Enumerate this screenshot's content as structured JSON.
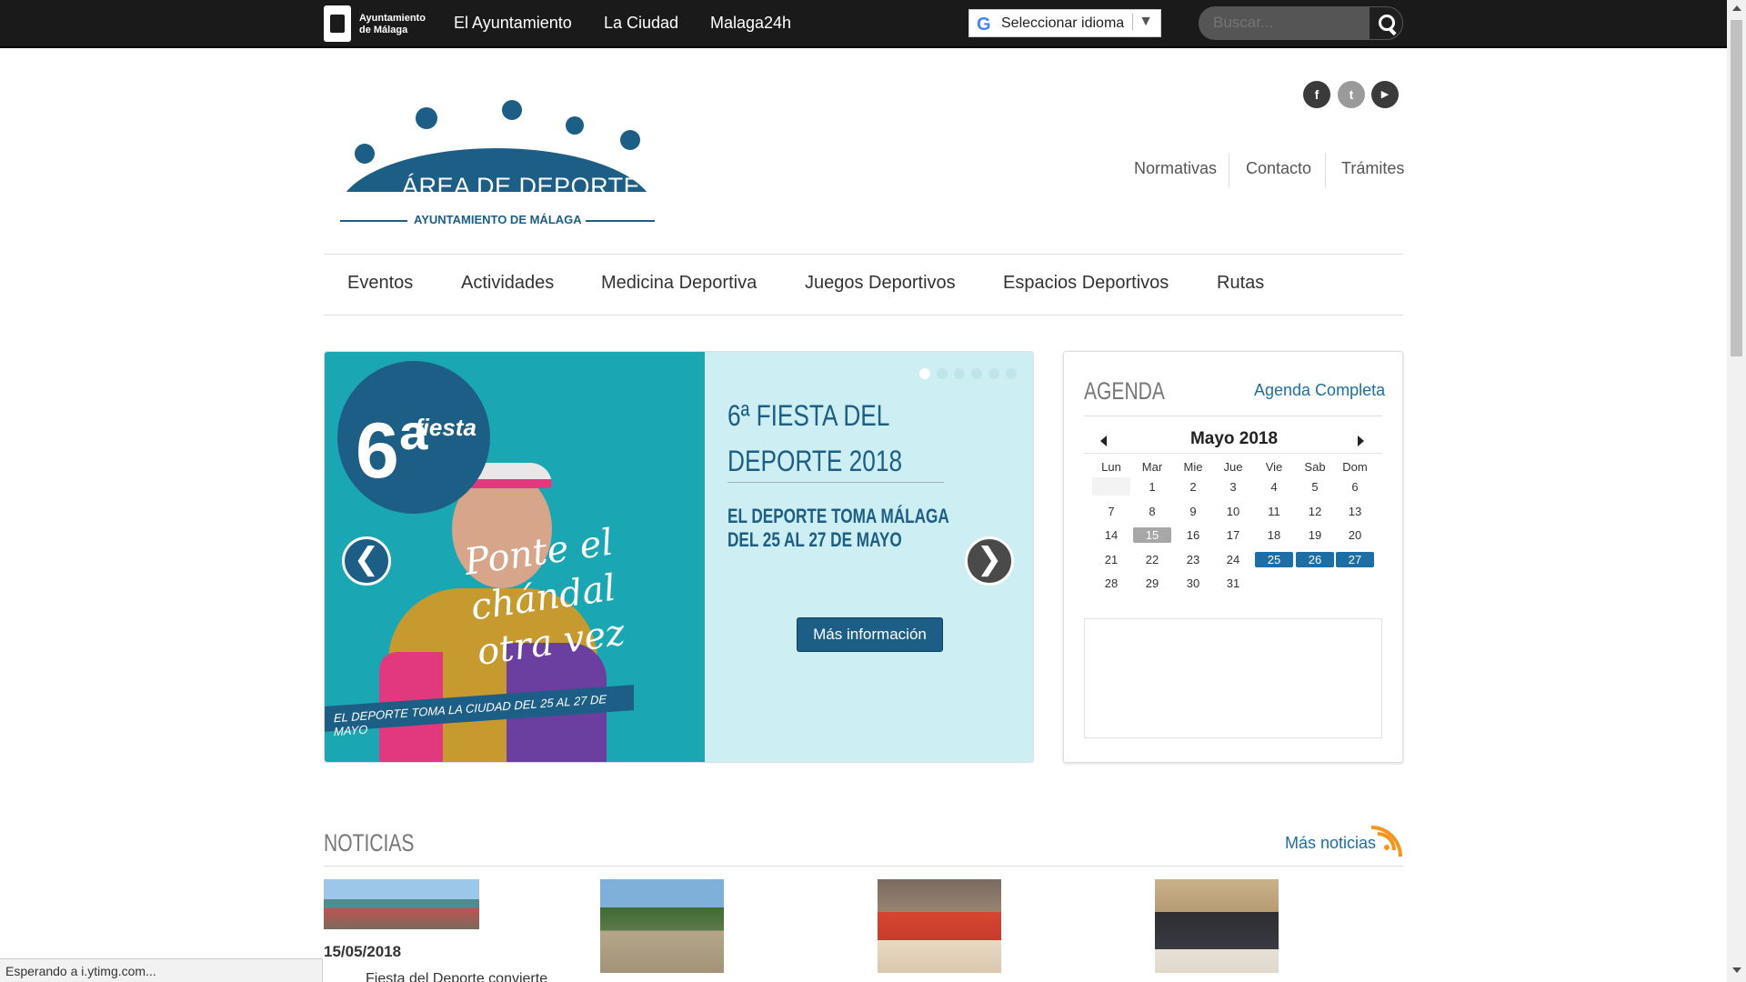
{
  "topbar": {
    "ayto_name": "Ayuntamiento de Málaga",
    "nav": [
      "El Ayuntamiento",
      "La Ciudad",
      "Malaga24h"
    ],
    "language_label": "Seleccionar idioma",
    "language_arrow": "▼",
    "google_glyph": "G",
    "search_placeholder": "Buscar..."
  },
  "brand": {
    "title": "ÁREA DE DEPORTE",
    "subtitle": "AYUNTAMIENTO DE MÁLAGA"
  },
  "social": [
    "facebook-icon",
    "twitter-icon",
    "youtube-icon"
  ],
  "social_glyphs": [
    "f",
    "t",
    "▶"
  ],
  "header_links": [
    "Normativas",
    "Contacto",
    "Trámites"
  ],
  "main_nav": [
    "Eventos",
    "Actividades",
    "Medicina Deportiva",
    "Juegos Deportivos",
    "Espacios Deportivos",
    "Rutas"
  ],
  "slider": {
    "poster_number": "6ª",
    "poster_brand": "fiesta",
    "poster_script": "Ponte el chándal otra vez",
    "poster_banner": "EL DEPORTE TOMA LA CIUDAD DEL 25 AL 27 DE MAYO",
    "title": "6ª FIESTA DEL DEPORTE 2018",
    "subtitle": "EL DEPORTE TOMA MÁLAGA DEL 25 AL 27 DE MAYO",
    "button": "Más información",
    "prev_glyph": "❮",
    "next_glyph": "❯",
    "slide_count": 6,
    "active_slide": 1
  },
  "agenda": {
    "title": "AGENDA",
    "link": "Agenda Completa",
    "month": "Mayo 2018",
    "weekdays": [
      "Lun",
      "Mar",
      "Mie",
      "Jue",
      "Vie",
      "Sab",
      "Dom"
    ],
    "weeks": [
      [
        "",
        "1",
        "2",
        "3",
        "4",
        "5",
        "6"
      ],
      [
        "7",
        "8",
        "9",
        "10",
        "11",
        "12",
        "13"
      ],
      [
        "14",
        "15",
        "16",
        "17",
        "18",
        "19",
        "20"
      ],
      [
        "21",
        "22",
        "23",
        "24",
        "25",
        "26",
        "27"
      ],
      [
        "28",
        "29",
        "30",
        "31",
        "",
        "",
        ""
      ]
    ],
    "today": "15",
    "event_days": [
      "25",
      "26",
      "27"
    ]
  },
  "news": {
    "title": "NOTICIAS",
    "more": "Más noticias",
    "first_date": "15/05/2018",
    "first_text": "Fiesta del Deporte convierte"
  },
  "status": "Esperando a i.ytimg.com...",
  "colors": {
    "brand_blue": "#1c5e85",
    "link_blue": "#1c6ea4",
    "slider_teal": "#1aa7b3",
    "slider_light": "#cdeef2",
    "topbar": "#1a1a1a"
  }
}
